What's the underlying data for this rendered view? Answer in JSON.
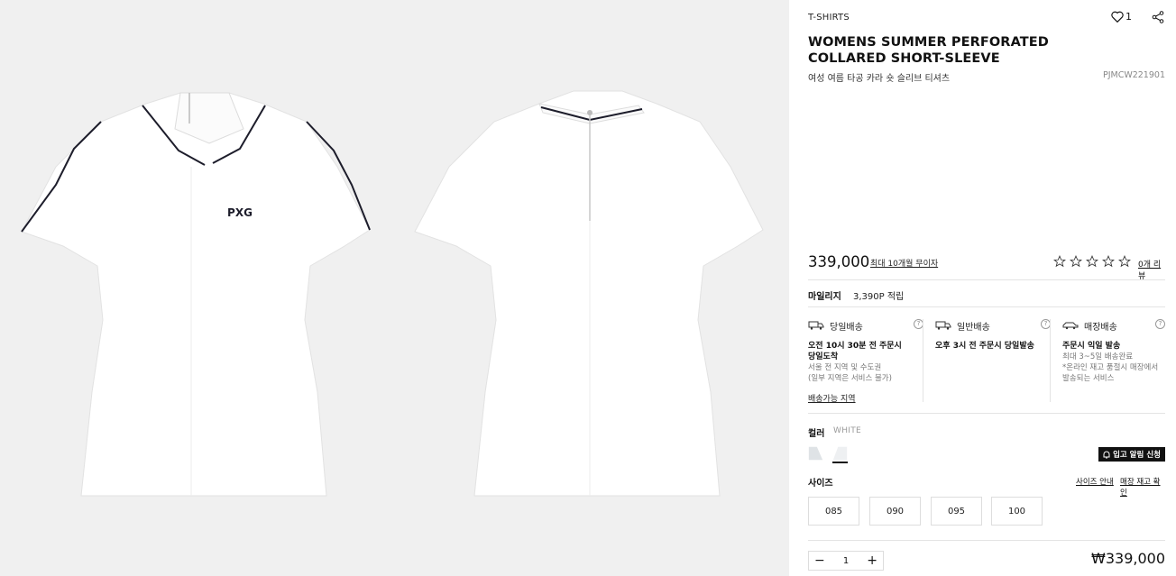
{
  "product": {
    "category": "T-SHIRTS",
    "likes": "1",
    "title": "WOMENS SUMMER PERFORATED COLLARED SHORT-SLEEVE",
    "subtitle": "여성 여름 타공 카라 숏 슬리브 티셔츠",
    "code": "PJMCW221901",
    "price": "339,000",
    "installment": "최대 10개월 무이자",
    "rating": 0,
    "reviews": "0개 리뷰"
  },
  "mileage": {
    "label": "마일리지",
    "value": "3,390P 적립"
  },
  "shipping": [
    {
      "title": "당일배송",
      "bold": "오전 10시 30분 전 주문시\n당일도착",
      "note": "서울 전 지역 및 수도권\n(일부 지역은 서비스 불가)"
    },
    {
      "title": "일반배송",
      "bold": "오후 3시 전 주문시 당일발송",
      "note": ""
    },
    {
      "title": "매장배송",
      "bold": "주문시 익일 발송",
      "note": "최대 3~5일 배송완료\n*온라인 재고 품절시 매장에서\n발송되는 서비스"
    }
  ],
  "shipping_link": "배송가능 지역",
  "color": {
    "label": "컬러",
    "value": "WHITE",
    "notify": "입고 알림 신청"
  },
  "size": {
    "label": "사이즈",
    "guide": "사이즈 안내",
    "stock": "매장 재고 확인",
    "options": [
      "085",
      "090",
      "095",
      "100"
    ]
  },
  "quantity": {
    "minus": "−",
    "value": "1",
    "plus": "+"
  },
  "total": "₩339,000",
  "images": {
    "logo_text": "PXG"
  }
}
